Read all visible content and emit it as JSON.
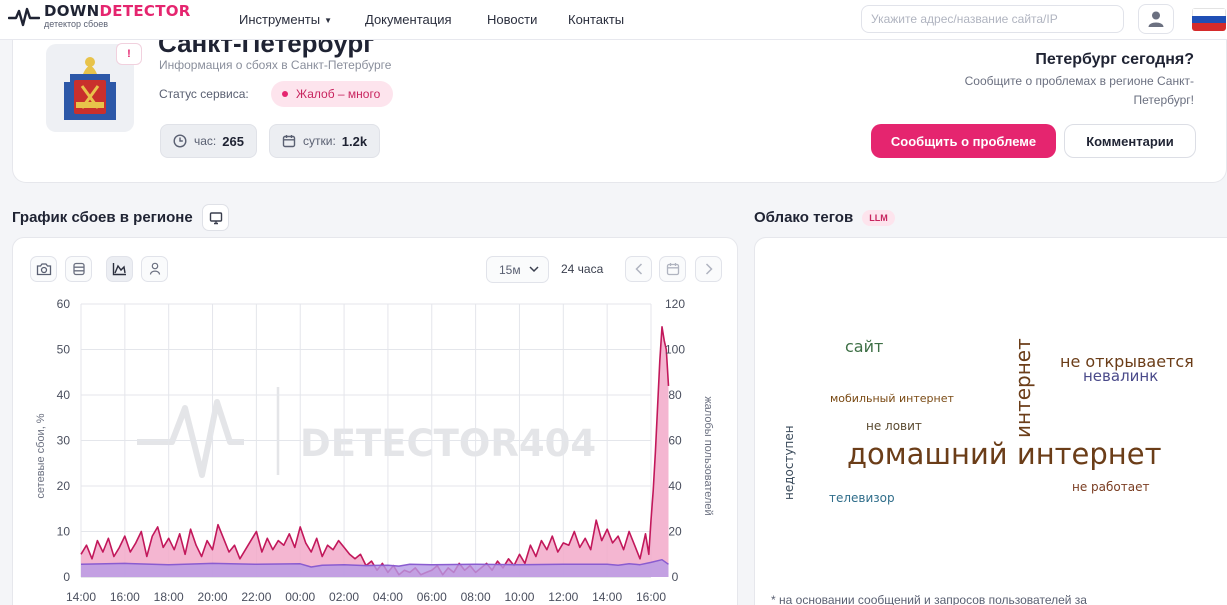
{
  "brand": {
    "name_part1": "DOWN",
    "name_part2": "DETECTOR",
    "tagline": "детектор сбоев",
    "accent_color": "#e5256f"
  },
  "nav": {
    "tools_label": "Инструменты",
    "docs_label": "Документация",
    "news_label": "Новости",
    "contacts_label": "Контакты",
    "search_placeholder": "Укажите адрес/название сайта/IP"
  },
  "region": {
    "title": "Санкт-Петербург",
    "subtitle": "Информация о сбоях в Санкт-Петербурге",
    "status_label": "Статус сервиса:",
    "status_value": "Жалоб – много",
    "hour_label": "час:",
    "hour_value": "265",
    "day_label": "сутки:",
    "day_value": "1.2k",
    "report_title": "Петербург сегодня?",
    "report_text": "Сообщите о проблемах в регионе Санкт-Петербург!",
    "report_button": "Сообщить о проблеме",
    "comments_button": "Комментарии"
  },
  "chart_section": {
    "title": "График сбоев в регионе",
    "period": "15м",
    "range": "24 часа"
  },
  "chart_data": {
    "type": "area",
    "xlabel": "",
    "ylabel": "сетевые сбои, %",
    "ylabel_right": "жалобы пользователей",
    "watermark": "DETECTOR404",
    "x_ticks": [
      "14:00",
      "16:00",
      "18:00",
      "20:00",
      "22:00",
      "00:00",
      "02:00",
      "04:00",
      "06:00",
      "08:00",
      "10:00",
      "12:00",
      "14:00",
      "16:00"
    ],
    "ylim": [
      0,
      60
    ],
    "y_ticks": [
      0,
      10,
      20,
      30,
      40,
      50,
      60
    ],
    "ylim_right": [
      0,
      120
    ],
    "y_ticks_right": [
      0,
      20,
      40,
      60,
      80,
      100,
      120
    ],
    "grid": true,
    "series": [
      {
        "axis": "right",
        "color": "#c2185b",
        "fill": "#f2a9c9",
        "x_hours": [
          0,
          0.25,
          0.5,
          0.75,
          1,
          1.25,
          1.5,
          1.75,
          2,
          2.25,
          2.5,
          2.75,
          3,
          3.25,
          3.5,
          3.75,
          4,
          4.25,
          4.5,
          4.75,
          5,
          5.25,
          5.5,
          5.75,
          6,
          6.25,
          6.5,
          6.75,
          7,
          7.25,
          7.5,
          7.75,
          8,
          8.25,
          8.5,
          8.75,
          9,
          9.25,
          9.5,
          9.75,
          10,
          10.25,
          10.5,
          10.75,
          11,
          11.25,
          11.5,
          11.75,
          12,
          12.25,
          12.5,
          12.75,
          13,
          13.25,
          13.5,
          13.75,
          14,
          14.25,
          14.5,
          14.75,
          15,
          15.25,
          15.5,
          15.75,
          16,
          16.25,
          16.5,
          16.75,
          17,
          17.25,
          17.5,
          17.75,
          18,
          18.25,
          18.5,
          18.75,
          19,
          19.25,
          19.5,
          19.75,
          20,
          20.25,
          20.5,
          20.75,
          21,
          21.25,
          21.5,
          21.75,
          22,
          22.25,
          22.5,
          22.75,
          23,
          23.25,
          23.5,
          23.75,
          24,
          24.25,
          24.5,
          24.75,
          25,
          25.25,
          25.5,
          25.75,
          25.9,
          26,
          26.1,
          26.2,
          26.3,
          26.4,
          26.5,
          26.6,
          26.7,
          26.8
        ],
        "values": [
          10,
          14,
          8,
          16,
          11,
          17,
          9,
          13,
          18,
          11,
          15,
          20,
          9,
          18,
          22,
          13,
          17,
          12,
          19,
          10,
          21,
          14,
          9,
          16,
          12,
          23,
          17,
          11,
          14,
          8,
          12,
          16,
          20,
          11,
          17,
          12,
          16,
          14,
          19,
          13,
          22,
          15,
          11,
          17,
          9,
          14,
          12,
          16,
          13,
          10,
          8,
          10,
          5,
          7,
          3,
          6,
          2,
          5,
          1,
          3,
          2,
          4,
          1,
          2,
          3,
          5,
          1,
          4,
          2,
          6,
          3,
          5,
          2,
          4,
          6,
          3,
          7,
          4,
          8,
          5,
          10,
          6,
          14,
          9,
          16,
          12,
          18,
          11,
          15,
          14,
          20,
          13,
          17,
          12,
          25,
          16,
          21,
          15,
          18,
          12,
          20,
          14,
          8,
          19,
          10,
          25,
          38,
          55,
          75,
          95,
          110,
          104,
          100,
          84
        ]
      },
      {
        "axis": "left",
        "color": "#8a5cd0",
        "fill": "#b79be6",
        "x_hours": [
          0,
          2,
          4,
          6,
          8,
          10,
          10.5,
          11,
          12,
          13,
          14,
          14.5,
          15,
          16,
          18,
          20,
          22,
          24,
          24.5,
          25,
          25.5,
          26,
          26.5,
          26.8
        ],
        "values": [
          2.8,
          3.0,
          2.7,
          3.0,
          2.8,
          2.9,
          2.2,
          2.6,
          2.7,
          2.5,
          2.6,
          2.4,
          2.8,
          2.7,
          2.8,
          2.7,
          2.8,
          2.8,
          2.6,
          2.9,
          2.7,
          3.2,
          3.8,
          2.8
        ]
      }
    ]
  },
  "tag_cloud": {
    "title": "Облако тегов",
    "badge": "LLM",
    "note": "*  на основании сообщений и запросов пользователей за",
    "tags": [
      {
        "text": "сайт",
        "color": "#3d6f45"
      },
      {
        "text": "интернет",
        "color": "#6b3d18"
      },
      {
        "text": "не открывается",
        "color": "#6b3d18"
      },
      {
        "text": "невалинк",
        "color": "#4a4a8a"
      },
      {
        "text": "мобильный интернет",
        "color": "#7a4a14"
      },
      {
        "text": "не ловит",
        "color": "#5a4a30"
      },
      {
        "text": "домашний интернет",
        "color": "#6b3d18"
      },
      {
        "text": "недоступен",
        "color": "#3a4a5a"
      },
      {
        "text": "телевизор",
        "color": "#2f6d8a"
      },
      {
        "text": "не работает",
        "color": "#7a3d22"
      }
    ]
  }
}
